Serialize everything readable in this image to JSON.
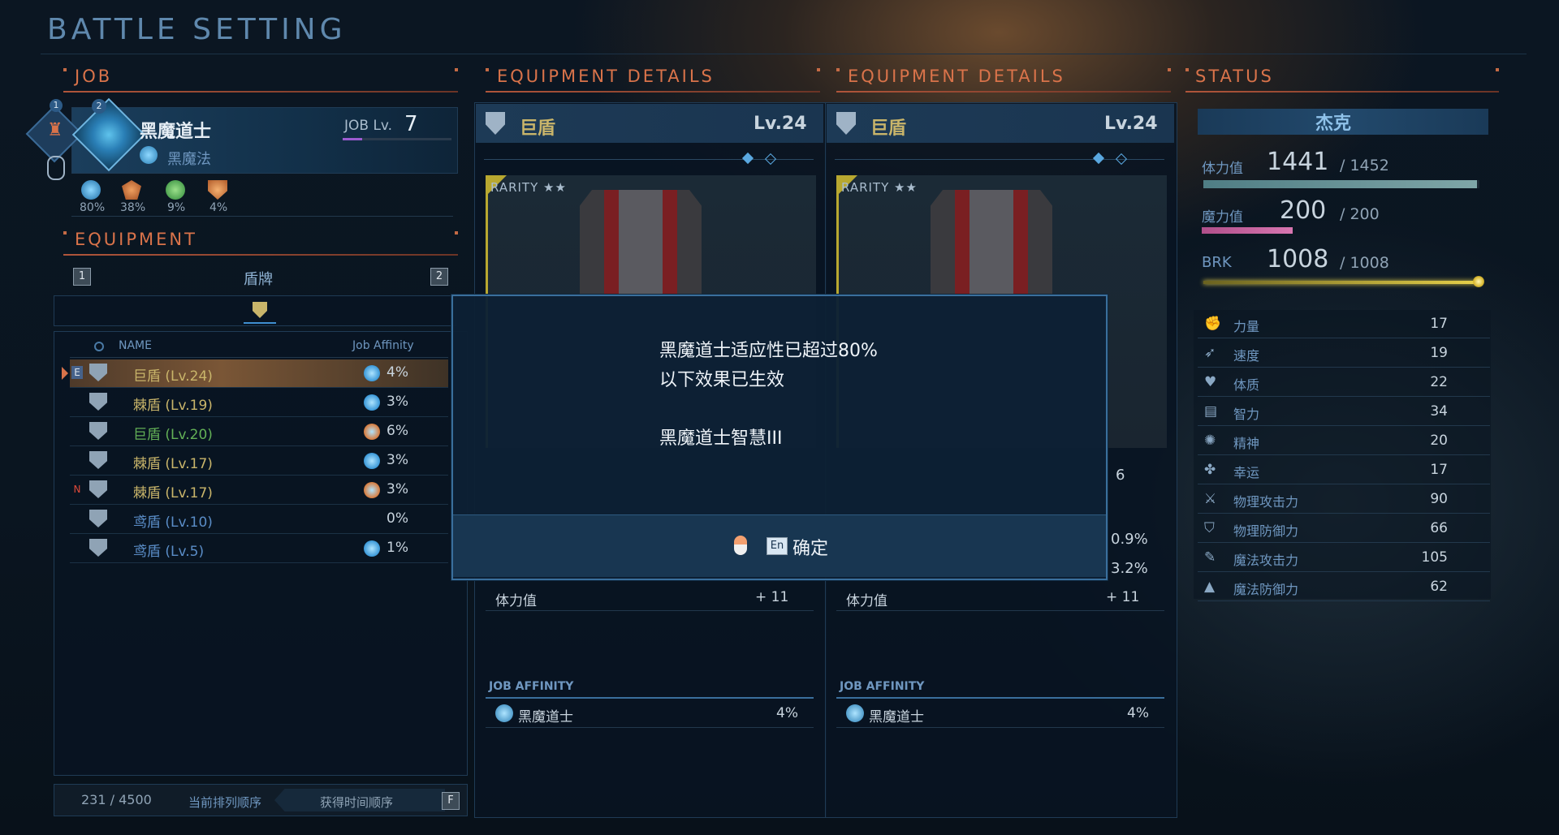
{
  "page_title": "BATTLE SETTING",
  "job": {
    "header": "JOB",
    "slot1": "1",
    "slot2": "2",
    "name": "黑魔道士",
    "subname": "黑魔法",
    "level_label": "JOB Lv.",
    "level": "7",
    "affinities": [
      "80%",
      "38%",
      "9%",
      "4%"
    ]
  },
  "equipment": {
    "header": "EQUIPMENT",
    "key_left": "1",
    "key_right": "2",
    "category": "盾牌",
    "col_name": "NAME",
    "col_affinity": "Job Affinity",
    "rows": [
      {
        "badge": "E",
        "name": "巨盾",
        "lv": "(Lv.24)",
        "aff": "4%",
        "color": "gold"
      },
      {
        "badge": "",
        "name": "棘盾",
        "lv": "(Lv.19)",
        "aff": "3%",
        "color": "gold"
      },
      {
        "badge": "",
        "name": "巨盾",
        "lv": "(Lv.20)",
        "aff": "6%",
        "color": "green"
      },
      {
        "badge": "",
        "name": "棘盾",
        "lv": "(Lv.17)",
        "aff": "3%",
        "color": "gold"
      },
      {
        "badge": "N",
        "name": "棘盾",
        "lv": "(Lv.17)",
        "aff": "3%",
        "color": "gold"
      },
      {
        "badge": "",
        "name": "鸢盾",
        "lv": "(Lv.10)",
        "aff": "0%",
        "color": "blue"
      },
      {
        "badge": "",
        "name": "鸢盾",
        "lv": "(Lv.5)",
        "aff": "1%",
        "color": "blue"
      }
    ],
    "count": "231 / 4500",
    "sort_label": "当前排列顺序",
    "sort_value": "获得时间顺序",
    "sort_key": "F"
  },
  "details": [
    {
      "header": "EQUIPMENT DETAILS",
      "name": "巨盾",
      "level": "Lv.24",
      "rarity": "RARITY ★★",
      "hp_label": "体力值",
      "hp_value": "+ 11",
      "affinity_header": "JOB AFFINITY",
      "affinity_job": "黑魔道士",
      "affinity_value": "4%"
    },
    {
      "header": "EQUIPMENT DETAILS",
      "name": "巨盾",
      "level": "Lv.24",
      "rarity": "RARITY ★★",
      "hp_label": "体力值",
      "hp_value": "+ 11",
      "affinity_header": "JOB AFFINITY",
      "affinity_job": "黑魔道士",
      "affinity_value": "4%",
      "side_value_1": "6",
      "side_value_2": "0.9%",
      "side_value_3": "3.2%"
    }
  ],
  "status": {
    "header": "STATUS",
    "character": "杰克",
    "hp_label": "体力值",
    "hp": "1441",
    "hp_max": "/ 1452",
    "hp_fraction": 0.992,
    "mp_label": "魔力值",
    "mp": "200",
    "mp_max": "/ 200",
    "mp_fraction": 1.0,
    "brk_label": "BRK",
    "brk": "1008",
    "brk_max": "/ 1008",
    "brk_fraction": 1.0,
    "stats": [
      {
        "icon": "strength-icon",
        "label": "力量",
        "value": "17"
      },
      {
        "icon": "speed-icon",
        "label": "速度",
        "value": "19"
      },
      {
        "icon": "heart-icon",
        "label": "体质",
        "value": "22"
      },
      {
        "icon": "book-icon",
        "label": "智力",
        "value": "34"
      },
      {
        "icon": "spirit-icon",
        "label": "精神",
        "value": "20"
      },
      {
        "icon": "clover-icon",
        "label": "幸运",
        "value": "17"
      },
      {
        "icon": "sword-icon",
        "label": "物理攻击力",
        "value": "90"
      },
      {
        "icon": "shield-icon",
        "label": "物理防御力",
        "value": "66"
      },
      {
        "icon": "wand-icon",
        "label": "魔法攻击力",
        "value": "105"
      },
      {
        "icon": "hat-icon",
        "label": "魔法防御力",
        "value": "62"
      }
    ]
  },
  "dialog": {
    "line1": "黑魔道士适应性已超过80%",
    "line2": "以下效果已生效",
    "line3": "黑魔道士智慧III",
    "key": "En",
    "confirm": "确定"
  },
  "colors": {
    "accent": "#d9734a",
    "panel": "#0d2338",
    "gold": "#c9b56a"
  }
}
